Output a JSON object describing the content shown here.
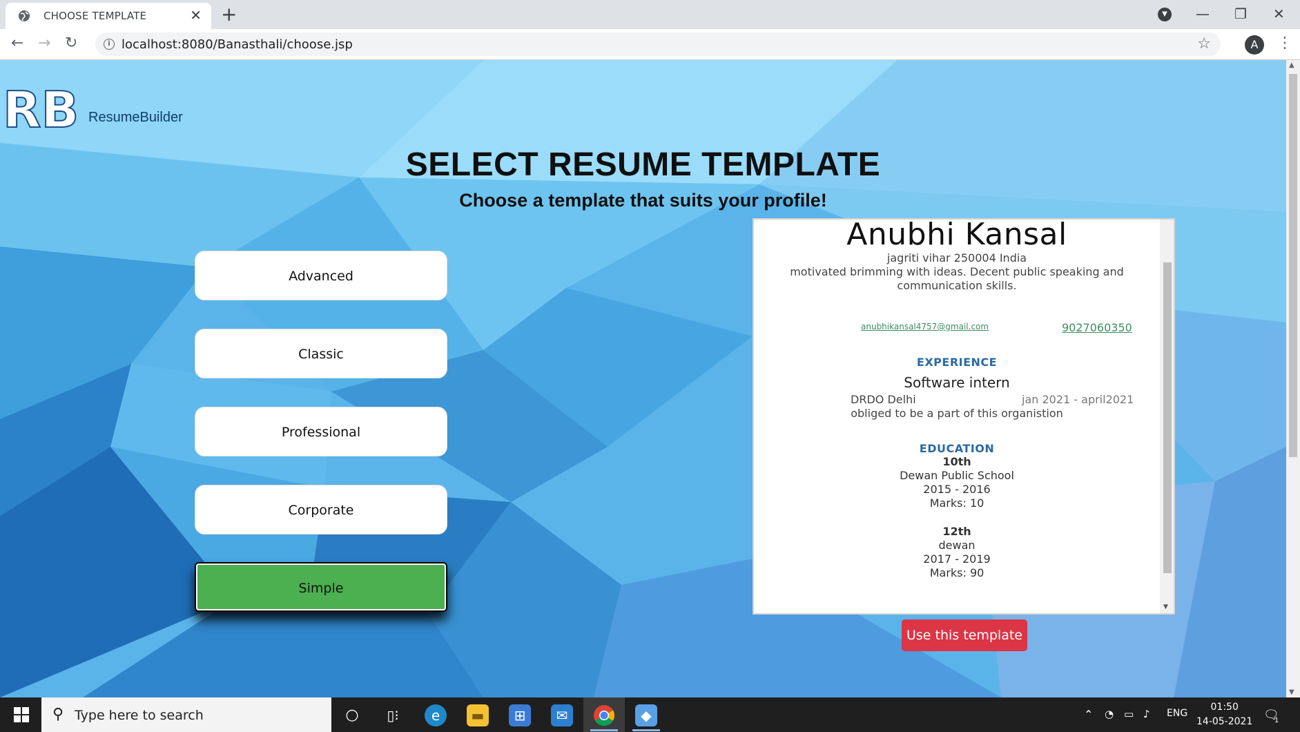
{
  "browser": {
    "tab_title": "CHOOSE TEMPLATE",
    "url": "localhost:8080/Banasthali/choose.jsp",
    "profile_initial": "A"
  },
  "page": {
    "brand": "ResumeBuilder",
    "logo_text": "RB",
    "heading": "SELECT RESUME TEMPLATE",
    "subheading": "Choose a template that suits your profile!",
    "templates": [
      {
        "label": "Advanced",
        "selected": false
      },
      {
        "label": "Classic",
        "selected": false
      },
      {
        "label": "Professional",
        "selected": false
      },
      {
        "label": "Corporate",
        "selected": false
      },
      {
        "label": "Simple",
        "selected": true
      }
    ],
    "use_button": "Use this template",
    "colors": {
      "selected": "#4caf50",
      "use_button": "#dc3545",
      "section_heading": "#2a6aa4",
      "link": "#3e8e5f"
    }
  },
  "resume": {
    "name": "Anubhi   Kansal",
    "address": "jagriti vihar   250004   India",
    "summary": "motivated brimming with ideas. Decent public speaking and communication skills.",
    "email": "anubhikansal4757@gmail.com",
    "phone": "9027060350",
    "experience_heading": "EXPERIENCE",
    "experience": {
      "role": "Software intern",
      "org": "DRDO Delhi",
      "dates": "jan 2021 - april2021",
      "description": "obliged to be a part of this organistion"
    },
    "education_heading": "EDUCATION",
    "education": [
      {
        "level": "10th",
        "school": "Dewan Public School",
        "years": "2015 - 2016",
        "marks": "Marks: 10"
      },
      {
        "level": "12th",
        "school": "dewan",
        "years": "2017 - 2019",
        "marks": "Marks: 90"
      }
    ]
  },
  "taskbar": {
    "search_placeholder": "Type here to search",
    "language": "ENG",
    "time": "01:50",
    "date": "14-05-2021",
    "notification_count": "1"
  }
}
